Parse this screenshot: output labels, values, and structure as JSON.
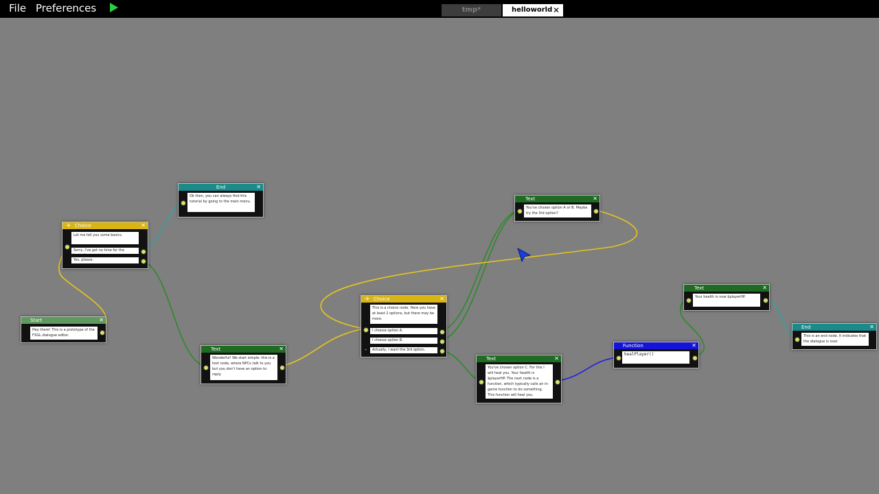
{
  "menu": {
    "file": "File",
    "preferences": "Preferences"
  },
  "tabs": [
    {
      "label": "tmp*"
    },
    {
      "label": "helloworld",
      "close": "✕"
    }
  ],
  "nodes": {
    "end1": {
      "title": "End",
      "close": "✕",
      "text": "Ok then, you can always find this tutorial by going to the main menu."
    },
    "choice1": {
      "title": "Choice",
      "close": "✕",
      "plus": "+",
      "text": "Let me tell you some basics.",
      "options": [
        "Sorry, I've got no time for the basics!",
        "Yes, please."
      ]
    },
    "start": {
      "title": "Start",
      "close": "✕",
      "text": "Hey there! This is a prototype of the FXGL dialogue editor."
    },
    "text1": {
      "title": "Text",
      "close": "✕",
      "text": "Wonderful! We start simple: this is a text node, where NPCs talk to you but you don't have an option to reply."
    },
    "choice2": {
      "title": "Choice",
      "close": "✕",
      "plus": "+",
      "minus": "-",
      "text": "This is a choice node. Here you have at least 2 options, but there may be more.",
      "options": [
        "I choose option A.",
        "I choose option B.",
        "Actually, I want the 3rd option."
      ]
    },
    "text2": {
      "title": "Text",
      "close": "✕",
      "text": "You've chosen option A or B. Maybe try the 3rd option?"
    },
    "text3": {
      "title": "Text",
      "close": "✕",
      "text": "You've chosen option C. For this I will heal you. Your health is $playerHP. The next node is a function, which typically calls an in-game function to do something. This function will heal you."
    },
    "function": {
      "title": "Function",
      "close": "✕",
      "text": "healPlayer()"
    },
    "text4": {
      "title": "Text",
      "close": "✕",
      "text": "Your health is now $playerHP."
    },
    "end2": {
      "title": "End",
      "close": "✕",
      "text": "This is an end node. It indicates that the dialogue is over."
    }
  },
  "colors": {
    "canvas": "#7f7f7f",
    "text_header": "#1f6b24",
    "choice_header": "#d8b414",
    "end_header": "#1a8a8a",
    "start_header": "#5e9a5e",
    "function_header": "#1414d8",
    "wire_green": "#2c8a2c",
    "wire_yellow": "#e6c51e",
    "wire_teal": "#3aa0a0",
    "wire_blue": "#2020e0",
    "pin": "#d8e06a"
  }
}
